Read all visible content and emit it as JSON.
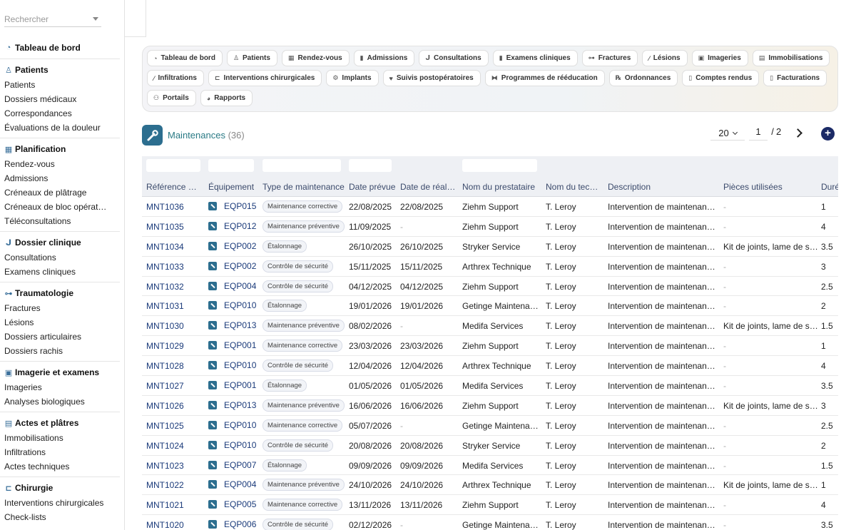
{
  "search": {
    "placeholder": "Rechercher"
  },
  "sidebar": {
    "sections": [
      {
        "title": "Tableau de bord",
        "icon": "dashboard-icon",
        "items": []
      },
      {
        "title": "Patients",
        "icon": "user-icon",
        "items": [
          "Patients",
          "Dossiers médicaux",
          "Correspondances",
          "Évaluations de la douleur"
        ]
      },
      {
        "title": "Planification",
        "icon": "calendar-icon",
        "items": [
          "Rendez-vous",
          "Admissions",
          "Créneaux de plâtrage",
          "Créneaux de bloc opérat…",
          "Téléconsultations"
        ]
      },
      {
        "title": "Dossier clinique",
        "icon": "stethoscope-icon",
        "items": [
          "Consultations",
          "Examens cliniques"
        ]
      },
      {
        "title": "Traumatologie",
        "icon": "bone-icon",
        "items": [
          "Fractures",
          "Lésions",
          "Dossiers articulaires",
          "Dossiers rachis"
        ]
      },
      {
        "title": "Imagerie et examens",
        "icon": "xray-icon",
        "items": [
          "Imageries",
          "Analyses biologiques"
        ]
      },
      {
        "title": "Actes et plâtres",
        "icon": "cast-icon",
        "items": [
          "Immobilisations",
          "Infiltrations",
          "Actes techniques"
        ]
      },
      {
        "title": "Chirurgie",
        "icon": "bed-icon",
        "items": [
          "Interventions chirurgicales",
          "Check-lists"
        ]
      }
    ]
  },
  "modules": [
    [
      {
        "label": "Tableau de bord",
        "icon": "dashboard-icon"
      },
      {
        "label": "Patients",
        "icon": "user-icon"
      },
      {
        "label": "Rendez-vous",
        "icon": "calendar-icon"
      },
      {
        "label": "Admissions",
        "icon": "clipboard-icon"
      },
      {
        "label": "Consultations",
        "icon": "stethoscope-icon"
      },
      {
        "label": "Examens cliniques",
        "icon": "clipboard-icon"
      },
      {
        "label": "Fractures",
        "icon": "bone-icon"
      },
      {
        "label": "Lésions",
        "icon": "bandage-icon"
      },
      {
        "label": "Imageries",
        "icon": "xray-icon"
      },
      {
        "label": "Immobilisations",
        "icon": "cast-icon"
      }
    ],
    [
      {
        "label": "Infiltrations",
        "icon": "syringe-icon"
      },
      {
        "label": "Interventions chirurgicales",
        "icon": "bed-icon"
      },
      {
        "label": "Implants",
        "icon": "gears-icon"
      },
      {
        "label": "Suivis postopératoires",
        "icon": "heart-icon"
      },
      {
        "label": "Programmes de rééducation",
        "icon": "dumbbell-icon"
      },
      {
        "label": "Ordonnances",
        "icon": "prescription-icon"
      },
      {
        "label": "Comptes rendus",
        "icon": "file-icon"
      },
      {
        "label": "Facturations",
        "icon": "invoice-icon"
      }
    ],
    [
      {
        "label": "Portails",
        "icon": "users-icon"
      },
      {
        "label": "Rapports",
        "icon": "pie-chart-icon"
      }
    ]
  ],
  "header": {
    "title": "Maintenances",
    "count": "(36)"
  },
  "pager": {
    "page_size": "20",
    "page": "1",
    "sep": "/",
    "total": "2"
  },
  "table": {
    "columns": [
      "Référence m…",
      "Équipement",
      "Type de maintenance",
      "Date prévue",
      "Date de réali…",
      "Nom du prestataire",
      "Nom du tech…",
      "Description",
      "Pièces utilisées",
      "Duré"
    ],
    "rows": [
      [
        "MNT1036",
        "EQP015",
        "Maintenance corrective",
        "22/08/2025",
        "22/08/2025",
        "Ziehm Support",
        "T. Leroy",
        "Intervention de maintenanc…",
        "-",
        "1"
      ],
      [
        "MNT1035",
        "EQP012",
        "Maintenance préventive",
        "11/09/2025",
        "-",
        "Ziehm Support",
        "T. Leroy",
        "Intervention de maintenanc…",
        "-",
        "4"
      ],
      [
        "MNT1034",
        "EQP002",
        "Étalonnage",
        "26/10/2025",
        "26/10/2025",
        "Stryker Service",
        "T. Leroy",
        "Intervention de maintenanc…",
        "Kit de joints, lame de scie",
        "3.5"
      ],
      [
        "MNT1033",
        "EQP002",
        "Contrôle de sécurité",
        "15/11/2025",
        "15/11/2025",
        "Arthrex Technique",
        "T. Leroy",
        "Intervention de maintenanc…",
        "-",
        "3"
      ],
      [
        "MNT1032",
        "EQP004",
        "Contrôle de sécurité",
        "04/12/2025",
        "04/12/2025",
        "Ziehm Support",
        "T. Leroy",
        "Intervention de maintenanc…",
        "-",
        "2.5"
      ],
      [
        "MNT1031",
        "EQP010",
        "Étalonnage",
        "19/01/2026",
        "19/01/2026",
        "Getinge Maintenance",
        "T. Leroy",
        "Intervention de maintenanc…",
        "-",
        "2"
      ],
      [
        "MNT1030",
        "EQP013",
        "Maintenance préventive",
        "08/02/2026",
        "-",
        "Medifa Services",
        "T. Leroy",
        "Intervention de maintenanc…",
        "Kit de joints, lame de scie",
        "1.5"
      ],
      [
        "MNT1029",
        "EQP001",
        "Maintenance corrective",
        "23/03/2026",
        "23/03/2026",
        "Ziehm Support",
        "T. Leroy",
        "Intervention de maintenanc…",
        "-",
        "1"
      ],
      [
        "MNT1028",
        "EQP010",
        "Contrôle de sécurité",
        "12/04/2026",
        "12/04/2026",
        "Arthrex Technique",
        "T. Leroy",
        "Intervention de maintenanc…",
        "-",
        "4"
      ],
      [
        "MNT1027",
        "EQP001",
        "Étalonnage",
        "01/05/2026",
        "01/05/2026",
        "Medifa Services",
        "T. Leroy",
        "Intervention de maintenanc…",
        "-",
        "3.5"
      ],
      [
        "MNT1026",
        "EQP013",
        "Maintenance préventive",
        "16/06/2026",
        "16/06/2026",
        "Ziehm Support",
        "T. Leroy",
        "Intervention de maintenanc…",
        "Kit de joints, lame de scie",
        "3"
      ],
      [
        "MNT1025",
        "EQP010",
        "Maintenance corrective",
        "05/07/2026",
        "-",
        "Getinge Maintenance",
        "T. Leroy",
        "Intervention de maintenanc…",
        "-",
        "2.5"
      ],
      [
        "MNT1024",
        "EQP010",
        "Contrôle de sécurité",
        "20/08/2026",
        "20/08/2026",
        "Stryker Service",
        "T. Leroy",
        "Intervention de maintenanc…",
        "-",
        "2"
      ],
      [
        "MNT1023",
        "EQP007",
        "Étalonnage",
        "09/09/2026",
        "09/09/2026",
        "Medifa Services",
        "T. Leroy",
        "Intervention de maintenanc…",
        "-",
        "1.5"
      ],
      [
        "MNT1022",
        "EQP004",
        "Maintenance préventive",
        "24/10/2026",
        "24/10/2026",
        "Arthrex Technique",
        "T. Leroy",
        "Intervention de maintenanc…",
        "Kit de joints, lame de scie",
        "1"
      ],
      [
        "MNT1021",
        "EQP005",
        "Maintenance corrective",
        "13/11/2026",
        "13/11/2026",
        "Ziehm Support",
        "T. Leroy",
        "Intervention de maintenanc…",
        "-",
        "4"
      ],
      [
        "MNT1020",
        "EQP006",
        "Contrôle de sécurité",
        "02/12/2026",
        "-",
        "Getinge Maintenance",
        "T. Leroy",
        "Intervention de maintenanc…",
        "-",
        "3.5"
      ]
    ]
  },
  "colors": {
    "accent": "#2c6e8f",
    "title": "#2a7a85",
    "link": "#1a3a7a",
    "add_button": "#1b2a66"
  }
}
